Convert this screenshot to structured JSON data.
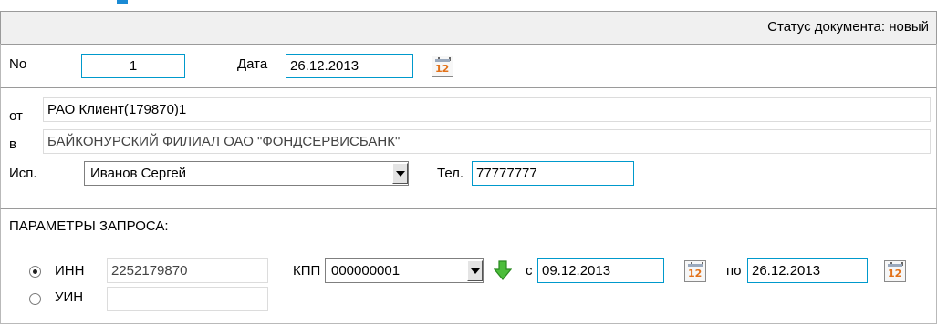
{
  "status": {
    "text": "Статус документа: новый"
  },
  "document": {
    "number_label": "No",
    "number_value": "1",
    "date_label": "Дата",
    "date_value": "26.12.2013"
  },
  "parties": {
    "from_label": "от",
    "from_value": "РАО Клиент(179870)1",
    "to_label": "в",
    "to_value": "БАЙКОНУРСКИЙ ФИЛИАЛ ОАО \"ФОНДСЕРВИСБАНК\"",
    "executor_label": "Исп.",
    "executor_value": "Иванов Сергей",
    "phone_label": "Тел.",
    "phone_value": "77777777"
  },
  "params": {
    "title": "ПАРАМЕТРЫ ЗАПРОСА:",
    "inn_label": "ИНН",
    "inn_value": "2252179870",
    "kpp_label": "КПП",
    "kpp_value": "000000001",
    "from_date_label": "с",
    "from_date_value": "09.12.2013",
    "to_date_label": "по",
    "to_date_value": "26.12.2013",
    "uin_label": "УИН",
    "uin_value": ""
  },
  "icons": {
    "calendar_number": "12"
  },
  "colors": {
    "accent": "#0099cc",
    "brand": "#1a8ad4",
    "arrow": "#3aa830"
  }
}
